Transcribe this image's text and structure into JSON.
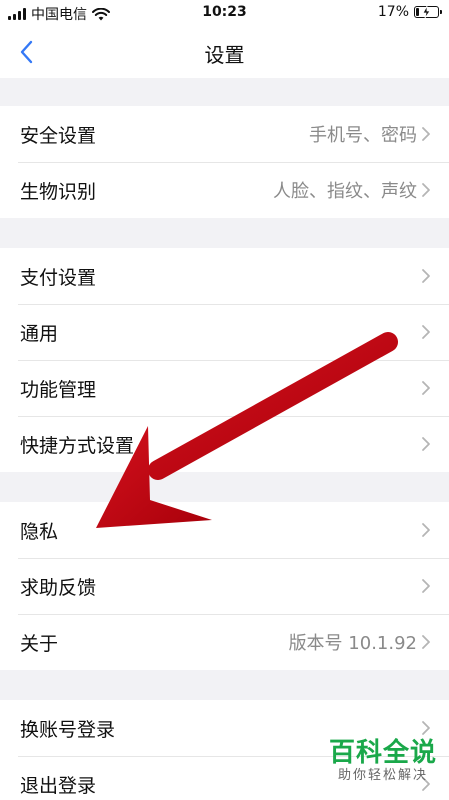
{
  "status_bar": {
    "carrier": "中国电信",
    "time": "10:23",
    "battery_percent": "17%",
    "battery_level": 0.17
  },
  "nav": {
    "title": "设置",
    "back_icon": "chevron-left-icon"
  },
  "groups": [
    {
      "items": [
        {
          "label": "安全设置",
          "value": "手机号、密码"
        },
        {
          "label": "生物识别",
          "value": "人脸、指纹、声纹"
        }
      ]
    },
    {
      "items": [
        {
          "label": "支付设置",
          "value": ""
        },
        {
          "label": "通用",
          "value": ""
        },
        {
          "label": "功能管理",
          "value": ""
        },
        {
          "label": "快捷方式设置",
          "value": ""
        }
      ]
    },
    {
      "items": [
        {
          "label": "隐私",
          "value": ""
        },
        {
          "label": "求助反馈",
          "value": ""
        },
        {
          "label": "关于",
          "value": "版本号 10.1.92"
        }
      ]
    },
    {
      "items": [
        {
          "label": "换账号登录",
          "value": ""
        },
        {
          "label": "退出登录",
          "value": ""
        }
      ]
    }
  ],
  "colors": {
    "accent": "#3478f6",
    "arrow": "#c0000c",
    "watermark": "#1aa84a"
  },
  "watermark": {
    "title": "百科全说",
    "subtitle": "助你轻松解决"
  }
}
